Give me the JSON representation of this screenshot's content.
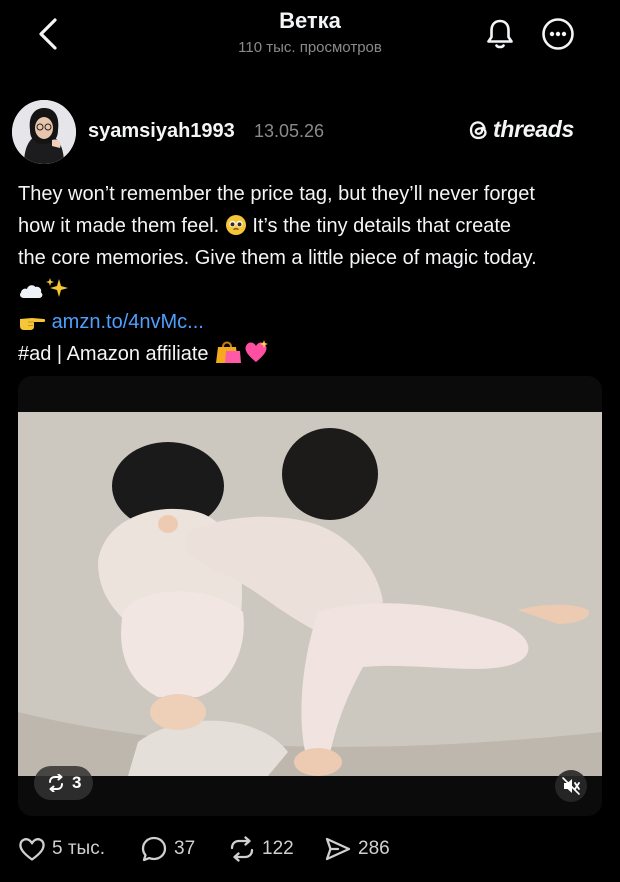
{
  "header": {
    "title": "Ветка",
    "views": "110 тыс. просмотров"
  },
  "post": {
    "username": "syamsiyah1993",
    "date": "13.05.26",
    "brand": "threads",
    "lines": [
      "They won’t remember the price tag, but they’ll never forget",
      "how it made them feel.",
      "It’s the tiny details that create",
      "the core memories. Give them a little piece of magic today."
    ],
    "link": "amzn.to/4nvMc...",
    "tags": "#ad | Amazon affiliate"
  },
  "media": {
    "repost_count": "3"
  },
  "actions": {
    "likes": "5 тыс.",
    "replies": "37",
    "reposts": "122",
    "shares": "286"
  },
  "icons": {
    "back": "chevron-left-icon",
    "bell": "bell-icon",
    "more": "more-icon",
    "like": "heart-icon",
    "reply": "comment-icon",
    "repost": "repost-icon",
    "share": "share-icon",
    "mute": "mute-icon"
  },
  "colors": {
    "background": "#000000",
    "text": "#f3f5f7",
    "secondary": "#8a8a8a",
    "link": "#4e9fff"
  }
}
